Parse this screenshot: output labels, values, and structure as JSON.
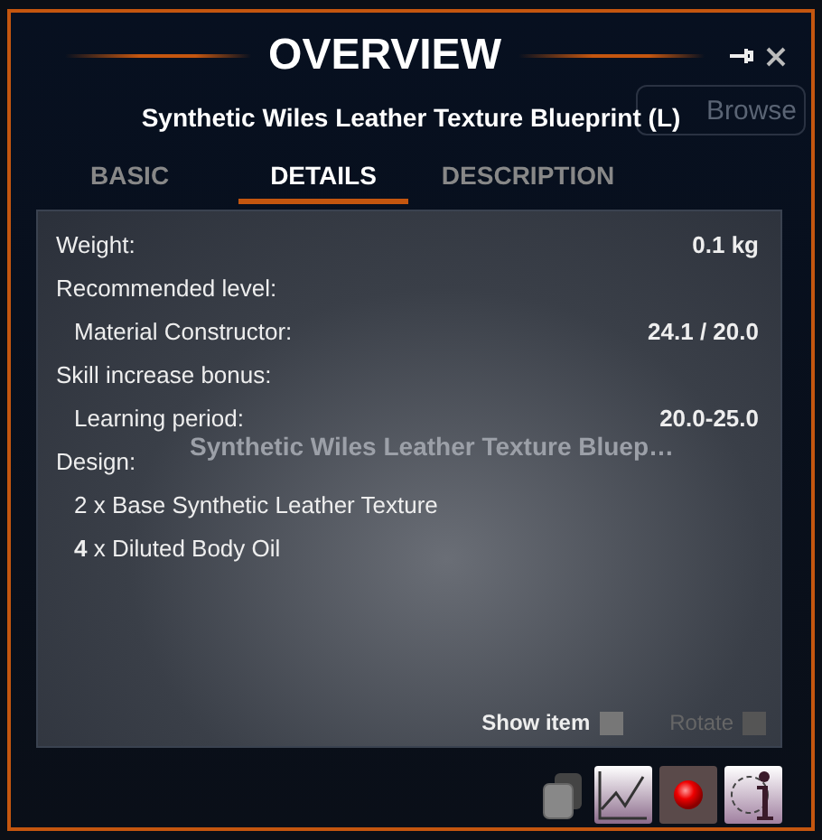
{
  "background": {
    "button": "Browse",
    "item_title": "Synthetic Wiles Leather Texture Bluep…"
  },
  "window": {
    "title": "OVERVIEW",
    "subtitle": "Synthetic Wiles Leather Texture Blueprint (L)"
  },
  "tabs": [
    {
      "label": "BASIC",
      "selected": false
    },
    {
      "label": "DETAILS",
      "selected": true
    },
    {
      "label": "DESCRIPTION",
      "selected": false
    }
  ],
  "details": [
    {
      "label": "Weight:",
      "value": "0.1 kg",
      "indented": false
    },
    {
      "label": "Recommended level:",
      "indented": false
    },
    {
      "label": "Material Constructor:",
      "value": "24.1 / 20.0",
      "indented": true
    },
    {
      "label": "Skill increase bonus:",
      "indented": false
    },
    {
      "label": "Learning period:",
      "value": "20.0-25.0",
      "indented": true
    },
    {
      "label": "Design:",
      "indented": false
    },
    {
      "label": "2 x Base Synthetic Leather Texture",
      "indented": true
    },
    {
      "label": "**4** x Diluted Body Oil",
      "indented": true
    }
  ],
  "options": [
    {
      "label": "Show item",
      "checked": false,
      "disabled": false
    },
    {
      "label": "Rotate",
      "checked": false,
      "disabled": true
    }
  ],
  "toolbar": [
    {
      "kind": "copy"
    },
    {
      "kind": "chart"
    },
    {
      "kind": "record"
    },
    {
      "kind": "info"
    }
  ]
}
